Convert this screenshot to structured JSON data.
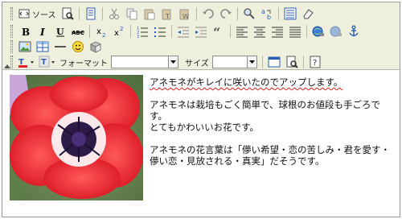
{
  "toolbar": {
    "source_label": "ソース",
    "font_format_label": "フォーマット",
    "font_size_label": "サイズ",
    "format_value": "",
    "size_value": ""
  },
  "content": {
    "line1": "アネモネがキレイに咲いたのでアップします。",
    "line2": "アネモネは栽培もごく簡単で、球根のお値段も手ごろで",
    "line3": "す。",
    "line4": "とてもかわいいお花です。",
    "line5": "アネモネの花言葉は「儚い希望・恋の苦しみ・君を愛す・",
    "line6": "儚い恋・見放される・真実」だそうです。"
  },
  "colors": {
    "toolbar_bg": "#efefde",
    "accent": "#2b5fb3",
    "flower_red": "#e3202b"
  },
  "icons": [
    "source-icon",
    "preview-icon",
    "template-icon",
    "cut-icon",
    "copy-icon",
    "paste-icon",
    "paste-text-icon",
    "paste-word-icon",
    "undo-icon",
    "redo-icon",
    "find-icon",
    "replace-icon",
    "select-all-icon",
    "remove-format-icon",
    "bold-icon",
    "italic-icon",
    "underline-icon",
    "strikethrough-icon",
    "subscript-icon",
    "superscript-icon",
    "numbered-list-icon",
    "bullet-list-icon",
    "outdent-icon",
    "indent-icon",
    "blockquote-icon",
    "align-left-icon",
    "align-center-icon",
    "align-right-icon",
    "justify-icon",
    "link-icon",
    "unlink-icon",
    "anchor-icon",
    "image-icon",
    "table-icon",
    "horizontal-rule-icon",
    "smiley-icon",
    "special-char-icon",
    "text-color-icon",
    "bg-color-icon",
    "maximize-icon",
    "show-blocks-icon",
    "about-icon"
  ]
}
